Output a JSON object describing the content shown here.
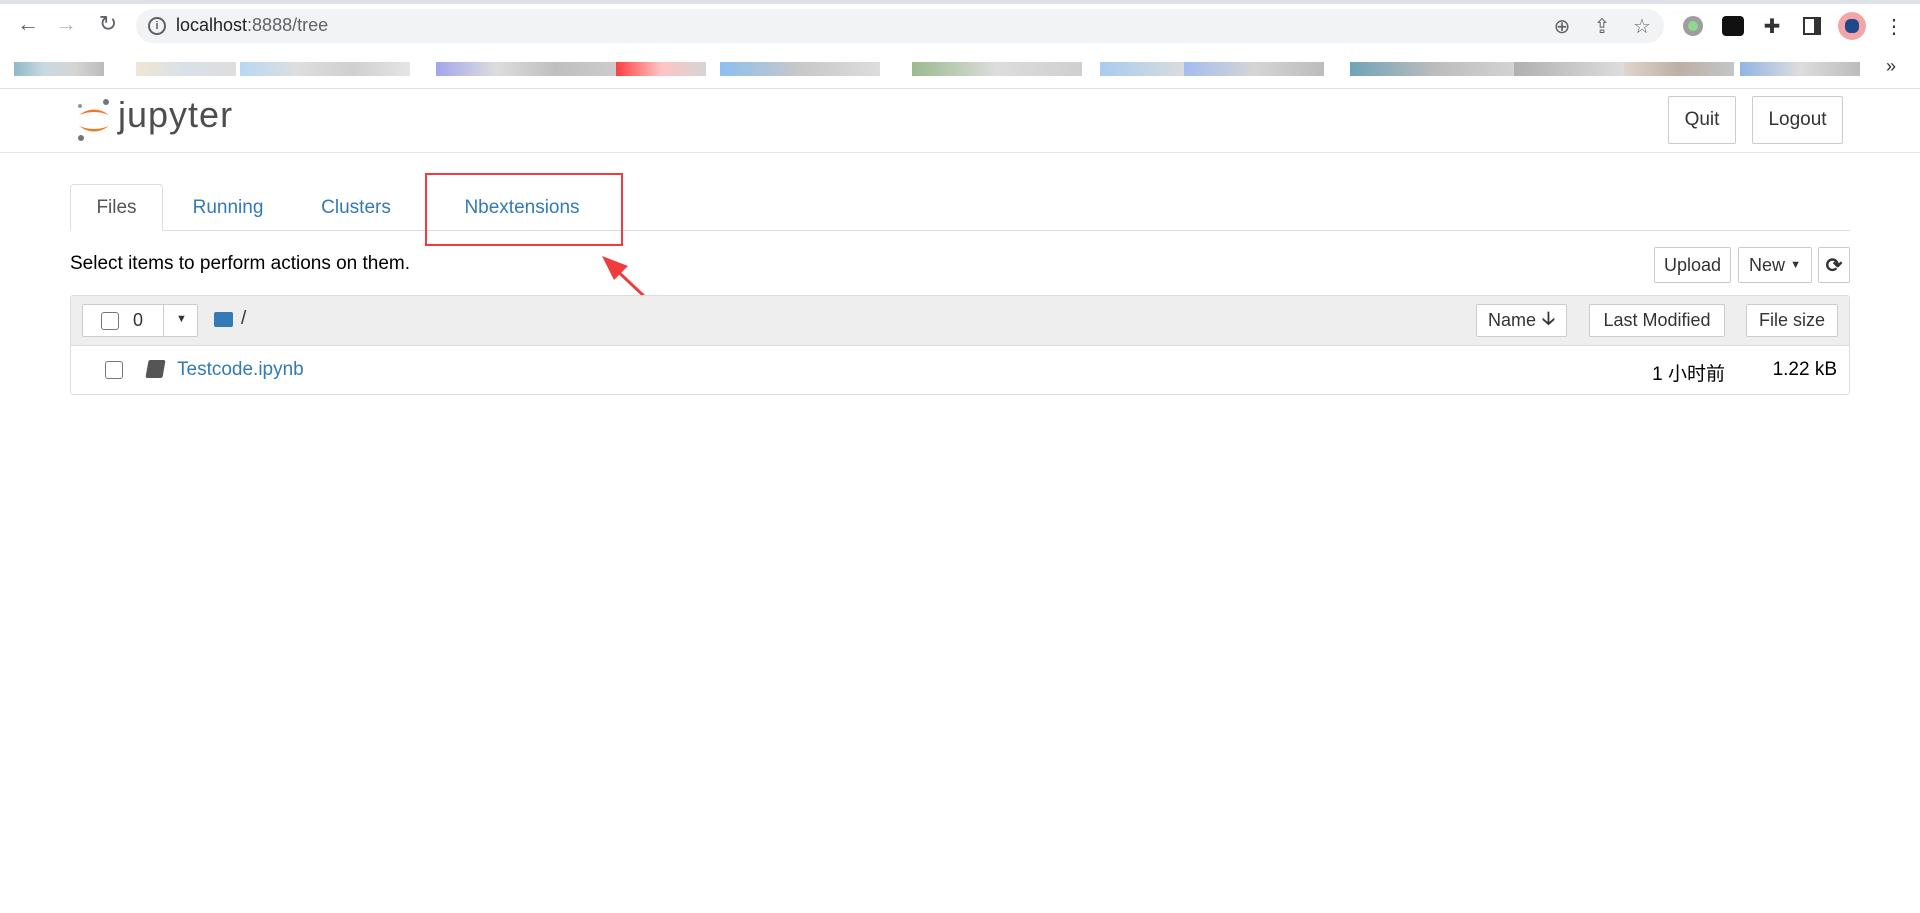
{
  "browser": {
    "url_host": "localhost",
    "url_rest": ":8888/tree",
    "bookmarks_overflow": "»"
  },
  "header": {
    "logo_text": "jupyter",
    "quit_label": "Quit",
    "logout_label": "Logout"
  },
  "tabs": [
    {
      "label": "Files",
      "active": true
    },
    {
      "label": "Running"
    },
    {
      "label": "Clusters"
    },
    {
      "label": "Nbextensions"
    }
  ],
  "toolbar": {
    "hint": "Select items to perform actions on them.",
    "upload_label": "Upload",
    "new_label": "New"
  },
  "list": {
    "selected_count": "0",
    "path": "/",
    "columns": {
      "name": "Name",
      "last_modified": "Last Modified",
      "file_size": "File size"
    },
    "rows": [
      {
        "name": "Testcode.ipynb",
        "modified": "1 小时前",
        "size": "1.22 kB"
      }
    ]
  },
  "colors": {
    "link": "#337ab7",
    "annotation": "#f03c3c",
    "logo_orange": "#f37726"
  }
}
